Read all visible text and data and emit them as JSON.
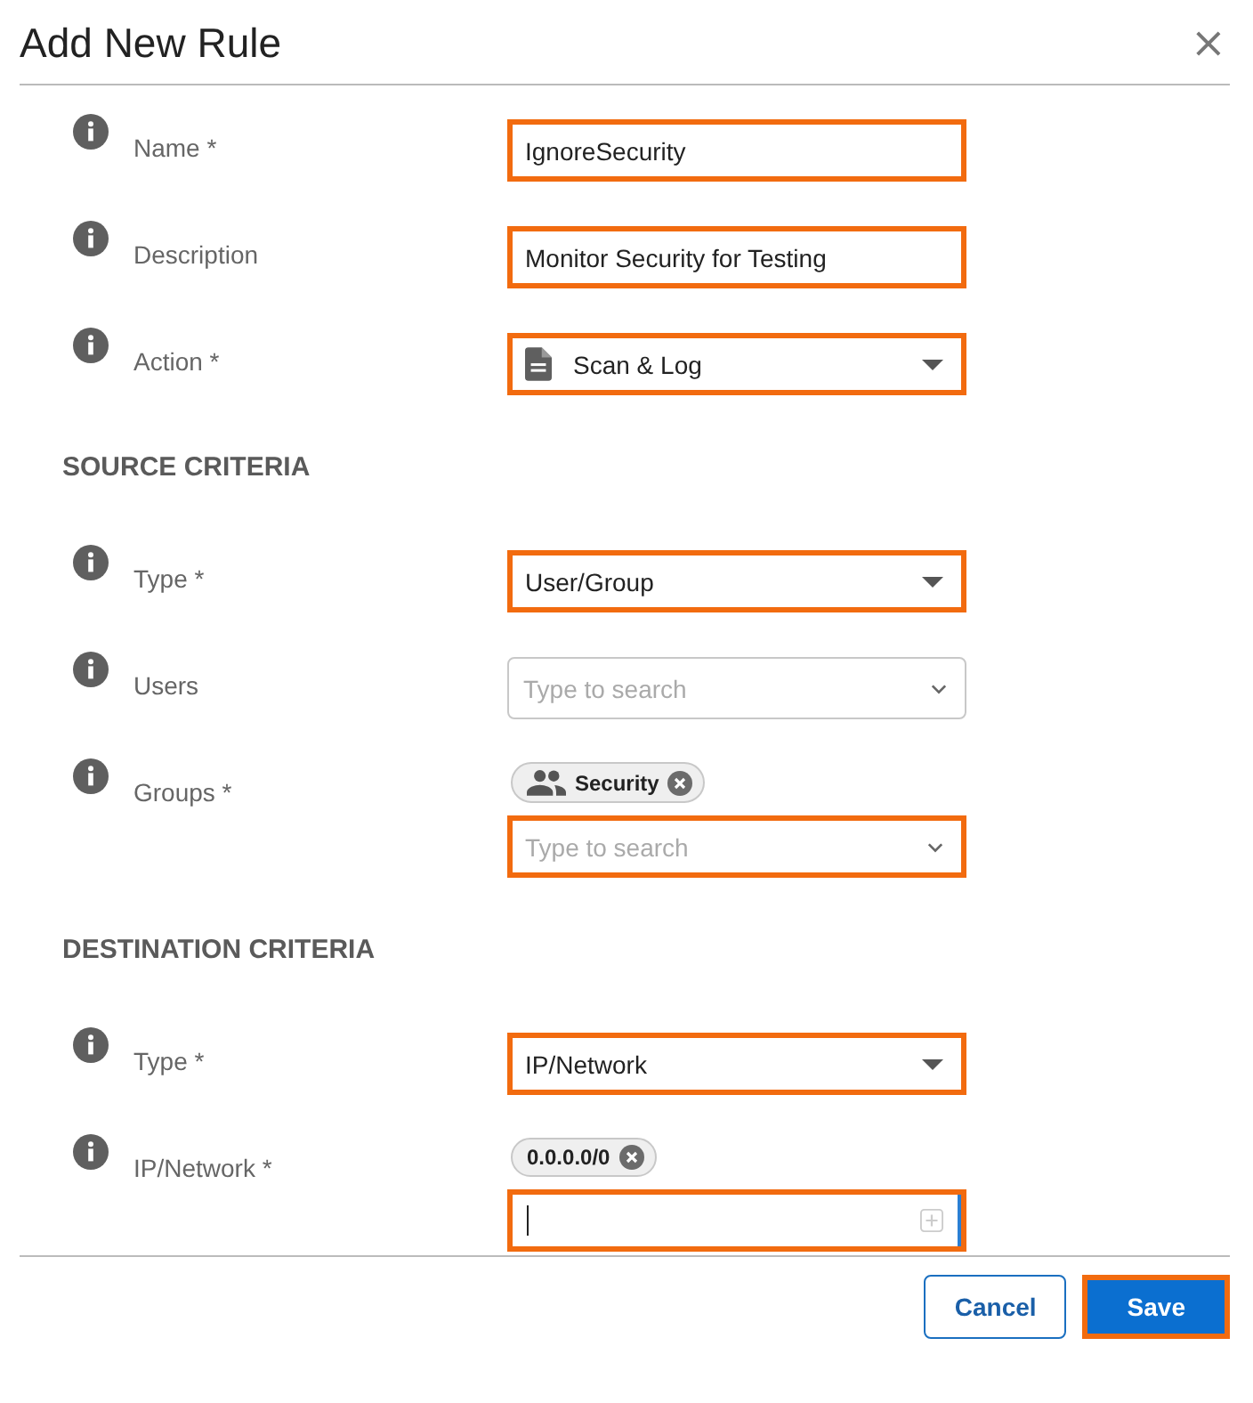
{
  "dialog": {
    "title": "Add New Rule",
    "close": "×"
  },
  "sections": [
    {
      "rows": [
        {
          "label": "Name *",
          "kind": "text",
          "value": "IgnoreSecurity",
          "highlighted": true,
          "focused": false
        },
        {
          "label": "Description",
          "kind": "text",
          "value": "Monitor Security for Testing",
          "highlighted": true,
          "focused": false
        },
        {
          "label": "Action *",
          "kind": "icon-select",
          "value": "Scan & Log",
          "highlighted": true,
          "focused": false
        }
      ]
    },
    {
      "heading": "SOURCE CRITERIA",
      "rows": [
        {
          "label": "Type *",
          "kind": "select",
          "value": "User/Group",
          "highlighted": true,
          "focused": false
        },
        {
          "label": "Users",
          "kind": "combo",
          "placeholder": "Type to search",
          "highlighted": false,
          "focused": false
        },
        {
          "label": "Groups *",
          "kind": "combo",
          "placeholder": "Type to search",
          "highlighted": true,
          "focused": false,
          "tags": [
            {
              "text": "Security",
              "kind": "group"
            }
          ]
        }
      ]
    },
    {
      "heading": "DESTINATION CRITERIA",
      "rows": [
        {
          "label": "Type *",
          "kind": "select",
          "value": "IP/Network",
          "highlighted": true,
          "focused": false
        },
        {
          "label": "IP/Network *",
          "kind": "tag-input",
          "highlighted": true,
          "focused": true,
          "tags": [
            {
              "text": "0.0.0.0/0",
              "kind": "address"
            }
          ]
        }
      ]
    }
  ],
  "buttons": [
    {
      "label": "Cancel",
      "kind": "secondary",
      "highlighted": false
    },
    {
      "label": "Save",
      "kind": "primary",
      "highlighted": true
    }
  ]
}
